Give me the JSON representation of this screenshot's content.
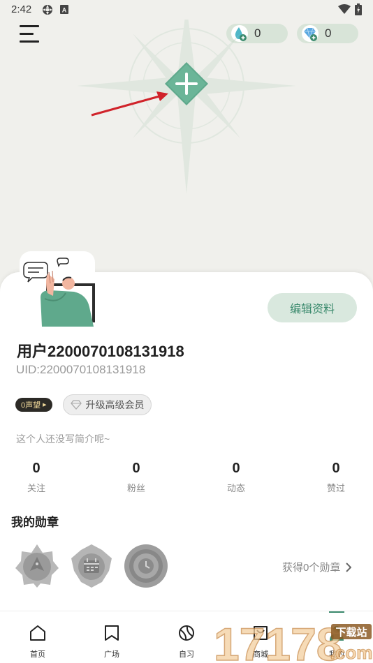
{
  "status_bar": {
    "time": "2:42",
    "icons": [
      "settings-gear-status-icon",
      "app-a-status-icon",
      "wifi-icon",
      "battery-icon"
    ]
  },
  "header": {
    "menu_icon": "menu-icon",
    "currencies": [
      {
        "icon": "water-drop-plus-icon",
        "value": "0"
      },
      {
        "icon": "diamond-plus-icon",
        "value": "0"
      }
    ],
    "add_icon": "plus-icon"
  },
  "profile": {
    "edit_label": "编辑资料",
    "username": "用户2200070108131918",
    "uid": "UID:2200070108131918",
    "reputation": "0声望",
    "upgrade_label": "升级高级会员",
    "bio": "这个人还没写简介呢~",
    "stats": [
      {
        "value": "0",
        "label": "关注"
      },
      {
        "value": "0",
        "label": "粉丝"
      },
      {
        "value": "0",
        "label": "动态"
      },
      {
        "value": "0",
        "label": "赞过"
      }
    ]
  },
  "medals": {
    "title": "我的勋章",
    "link": "获得0个勋章",
    "items": [
      "bird-medal-icon",
      "calendar-medal-icon",
      "clock-medal-icon"
    ]
  },
  "nav": {
    "items": [
      {
        "label": "首页",
        "icon": "home-icon"
      },
      {
        "label": "广场",
        "icon": "book-icon"
      },
      {
        "label": "自习",
        "icon": "planet-icon"
      },
      {
        "label": "商城",
        "icon": "shop-icon"
      },
      {
        "label": "我的",
        "icon": "profile-icon"
      }
    ]
  },
  "watermark": {
    "text": "17178",
    "sub1": "下载站",
    "sub2": ".com"
  },
  "colors": {
    "accent": "#3b8a6d",
    "accent_light": "#d9e8de",
    "header_bg": "#f0f0ec",
    "arrow": "#d0232a"
  }
}
